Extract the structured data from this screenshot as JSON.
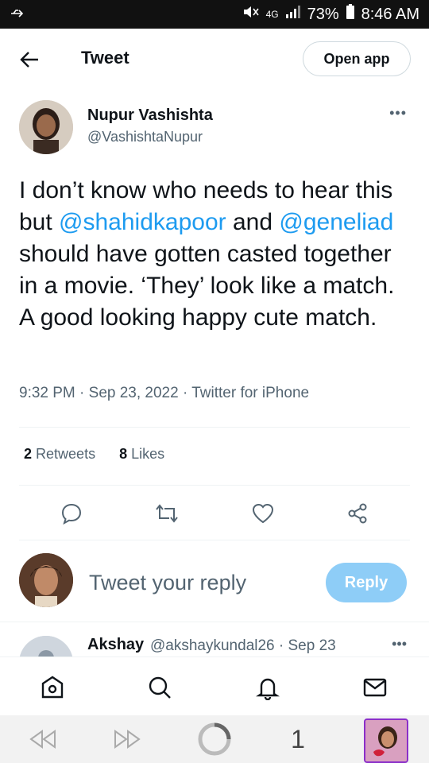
{
  "status_bar": {
    "left_icon": "usb-icon",
    "network_label": "4G",
    "battery": "73%",
    "time": "8:46 AM"
  },
  "header": {
    "title": "Tweet",
    "open_app_label": "Open app"
  },
  "tweet": {
    "author_name": "Nupur Vashishta",
    "author_handle": "@VashishtaNupur",
    "text_1": "I don’t know who needs to hear this but ",
    "mention_1": "@shahidkapoor",
    "text_2": " and ",
    "mention_2": "@geneliad",
    "text_3": " should have gotten casted together in a movie. ‘They’ look like a match. A good looking happy cute match.",
    "meta": "9:32 PM · Sep 23, 2022 · Twitter for iPhone",
    "retweets_count": "2",
    "retweets_label": "Retweets",
    "likes_count": "8",
    "likes_label": "Likes"
  },
  "reply_box": {
    "placeholder": "Tweet your reply",
    "button_label": "Reply"
  },
  "reply_preview": {
    "name": "Akshay",
    "handle_date": "@akshaykundal26 · Sep 23"
  },
  "browser": {
    "tab_count": "1"
  },
  "colors": {
    "accent": "#1d9bf0",
    "reply_button": "#8ecdf7",
    "secondary_text": "#536471"
  }
}
